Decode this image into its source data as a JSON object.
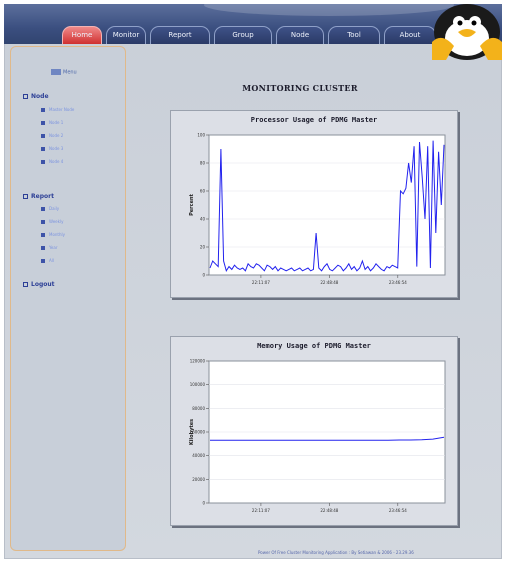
{
  "header": {
    "tabs": [
      {
        "label": "Home",
        "active": true
      },
      {
        "label": "Monitor",
        "active": false
      },
      {
        "label": "Report",
        "active": false
      },
      {
        "label": "Group",
        "active": false
      },
      {
        "label": "Node",
        "active": false
      },
      {
        "label": "Tool",
        "active": false
      },
      {
        "label": "About",
        "active": false
      }
    ]
  },
  "sidebar": {
    "heading": "Menu",
    "sections": [
      {
        "title": "Node",
        "items": [
          "Master Node",
          "Node 1",
          "Node 2",
          "Node 3",
          "Node 4"
        ]
      },
      {
        "title": "Report",
        "items": [
          "Daily",
          "Weekly",
          "Monthly",
          "Year",
          "All"
        ]
      }
    ],
    "logout": "Logout"
  },
  "main": {
    "title": "MONITORING CLUSTER"
  },
  "chart_data": [
    {
      "type": "line",
      "title": "Processor Usage of PDMG Master",
      "ylabel": "Percent",
      "xlabel": "",
      "ylim": [
        0,
        100
      ],
      "yticks": [
        "0",
        "20",
        "40",
        "60",
        "80",
        "100"
      ],
      "xticks": [
        "22:11:07",
        "22:48:48",
        "23:46:54"
      ],
      "color": "#2222ee",
      "series": [
        {
          "values": [
            5,
            10,
            8,
            6,
            90,
            10,
            3,
            6,
            4,
            7,
            5,
            4,
            5,
            3,
            8,
            6,
            5,
            8,
            7,
            5,
            3,
            7,
            6,
            4,
            6,
            3,
            5,
            4,
            3,
            4,
            5,
            3,
            4,
            5,
            3,
            4,
            5,
            3,
            4,
            30,
            5,
            3,
            6,
            8,
            4,
            3,
            5,
            7,
            6,
            3,
            5,
            8,
            4,
            6,
            3,
            5,
            10,
            4,
            6,
            3,
            5,
            8,
            6,
            4,
            3,
            6,
            5,
            7,
            6,
            5,
            60,
            58,
            62,
            80,
            66,
            92,
            6,
            95,
            70,
            40,
            92,
            5,
            96,
            30,
            88,
            50,
            93
          ]
        }
      ]
    },
    {
      "type": "line",
      "title": "Memory Usage of PDMG Master",
      "ylabel": "Kilobytes",
      "xlabel": "",
      "ylim": [
        0,
        120000
      ],
      "yticks": [
        "0",
        "20000",
        "40000",
        "60000",
        "80000",
        "100000",
        "120000"
      ],
      "xticks": [
        "22:11:07",
        "22:48:48",
        "23:46:54"
      ],
      "color": "#2222ee",
      "series": [
        {
          "values": [
            53000,
            53000,
            53000,
            53000,
            53000,
            53000,
            53000,
            53000,
            53000,
            53000,
            53000,
            53000,
            53000,
            53000,
            53000,
            53000,
            53000,
            53200,
            53200,
            53500,
            54000,
            55500
          ]
        }
      ]
    }
  ],
  "footer": {
    "text": "Power Of Free Cluster Monitoring Application : By Setiawan & 2006 - 23.29.36"
  }
}
